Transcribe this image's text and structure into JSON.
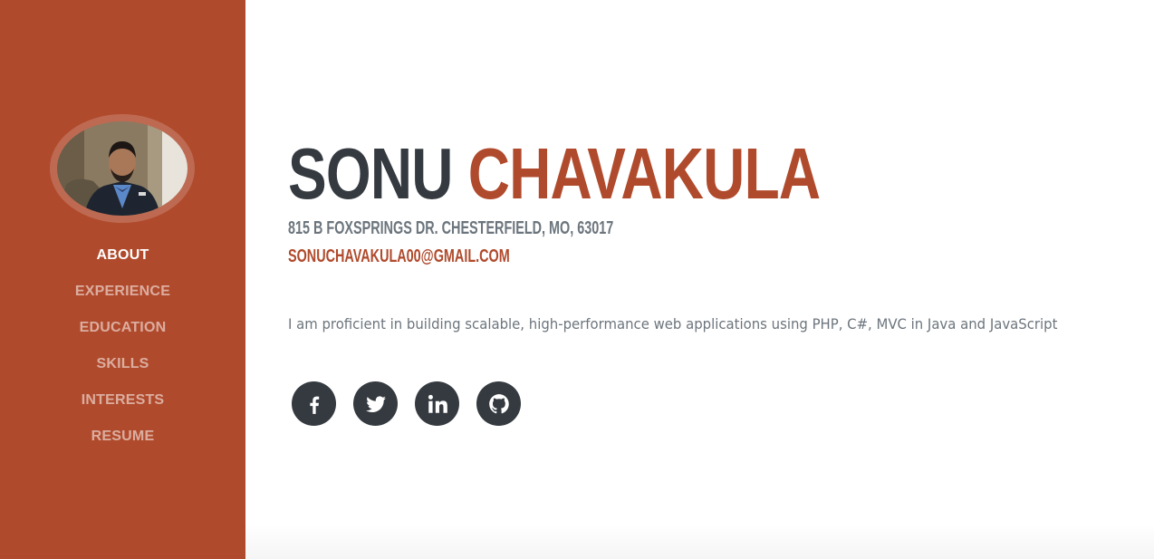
{
  "sidebar": {
    "background": "#b04a2c",
    "avatar_alt": "Profile photo",
    "nav": [
      {
        "label": "About",
        "active": true
      },
      {
        "label": "Experience",
        "active": false
      },
      {
        "label": "Education",
        "active": false
      },
      {
        "label": "Skills",
        "active": false
      },
      {
        "label": "Interests",
        "active": false
      },
      {
        "label": "Resume",
        "active": false
      }
    ]
  },
  "about": {
    "first_name": "Sonu",
    "last_name": "Chavakula",
    "address": "815 B Foxsprings Dr. Chesterfield, MO, 63017",
    "email": "sonuchavakula00@gmail.com",
    "lead": "I am proficient in building scalable, high-performance web applications using PHP, C#, MVC in Java and JavaScript"
  },
  "social": [
    {
      "name": "facebook-icon"
    },
    {
      "name": "twitter-icon"
    },
    {
      "name": "linkedin-icon"
    },
    {
      "name": "github-icon"
    }
  ],
  "colors": {
    "accent": "#b04a2c",
    "dark": "#343a40",
    "muted": "#6c757d"
  }
}
